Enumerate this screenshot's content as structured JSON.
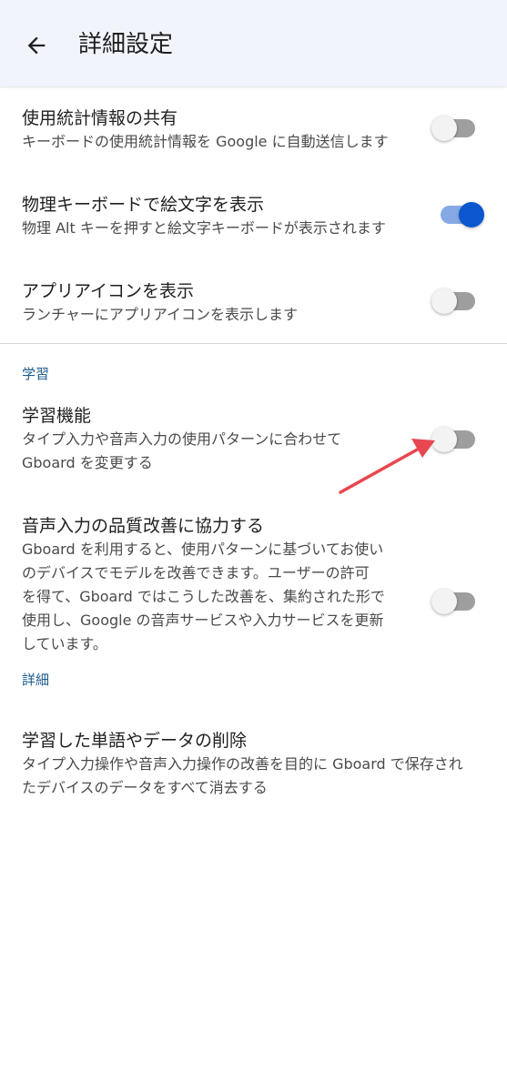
{
  "header": {
    "title": "詳細設定",
    "back_icon": "arrow-back-icon"
  },
  "settings": [
    {
      "title": "使用統計情報の共有",
      "subtitle": "キーボードの使用統計情報を Google に自動送信します",
      "enabled": false
    },
    {
      "title": "物理キーボードで絵文字を表示",
      "subtitle": "物理 Alt キーを押すと絵文字キーボードが表示されます",
      "enabled": true
    },
    {
      "title": "アプリアイコンを表示",
      "subtitle": "ランチャーにアプリアイコンを表示します",
      "enabled": false
    }
  ],
  "learning_section": {
    "header": "学習",
    "items": [
      {
        "title": "学習機能",
        "subtitle_lines": [
          "タイプ入力や音声入力の使用パターンに合わせて",
          "Gboard を変更する"
        ],
        "enabled": false
      },
      {
        "title": "音声入力の品質改善に協力する",
        "subtitle_lines": [
          "Gboard を利用すると、使用パターンに基づいてお使い",
          "のデバイスでモデルを改善できます。ユーザーの許可",
          "を得て、Gboard ではこうした改善を、集約された形で",
          "使用し、Google の音声サービスや入力サービスを更新",
          "しています。"
        ],
        "enabled": false
      }
    ]
  },
  "details_section": {
    "header": "詳細",
    "items": [
      {
        "title": "学習した単語やデータの削除",
        "subtitle_lines": [
          "タイプ入力操作や音声入力操作の改善を目的に Gboard で保存され",
          "たデバイスのデータをすべて消去する"
        ]
      }
    ]
  },
  "colors": {
    "accent": "#0b57d0",
    "section_header": "#1a5a8e",
    "annotation_arrow": "#e8474f",
    "appbar_bg": "#f1f4fb"
  }
}
